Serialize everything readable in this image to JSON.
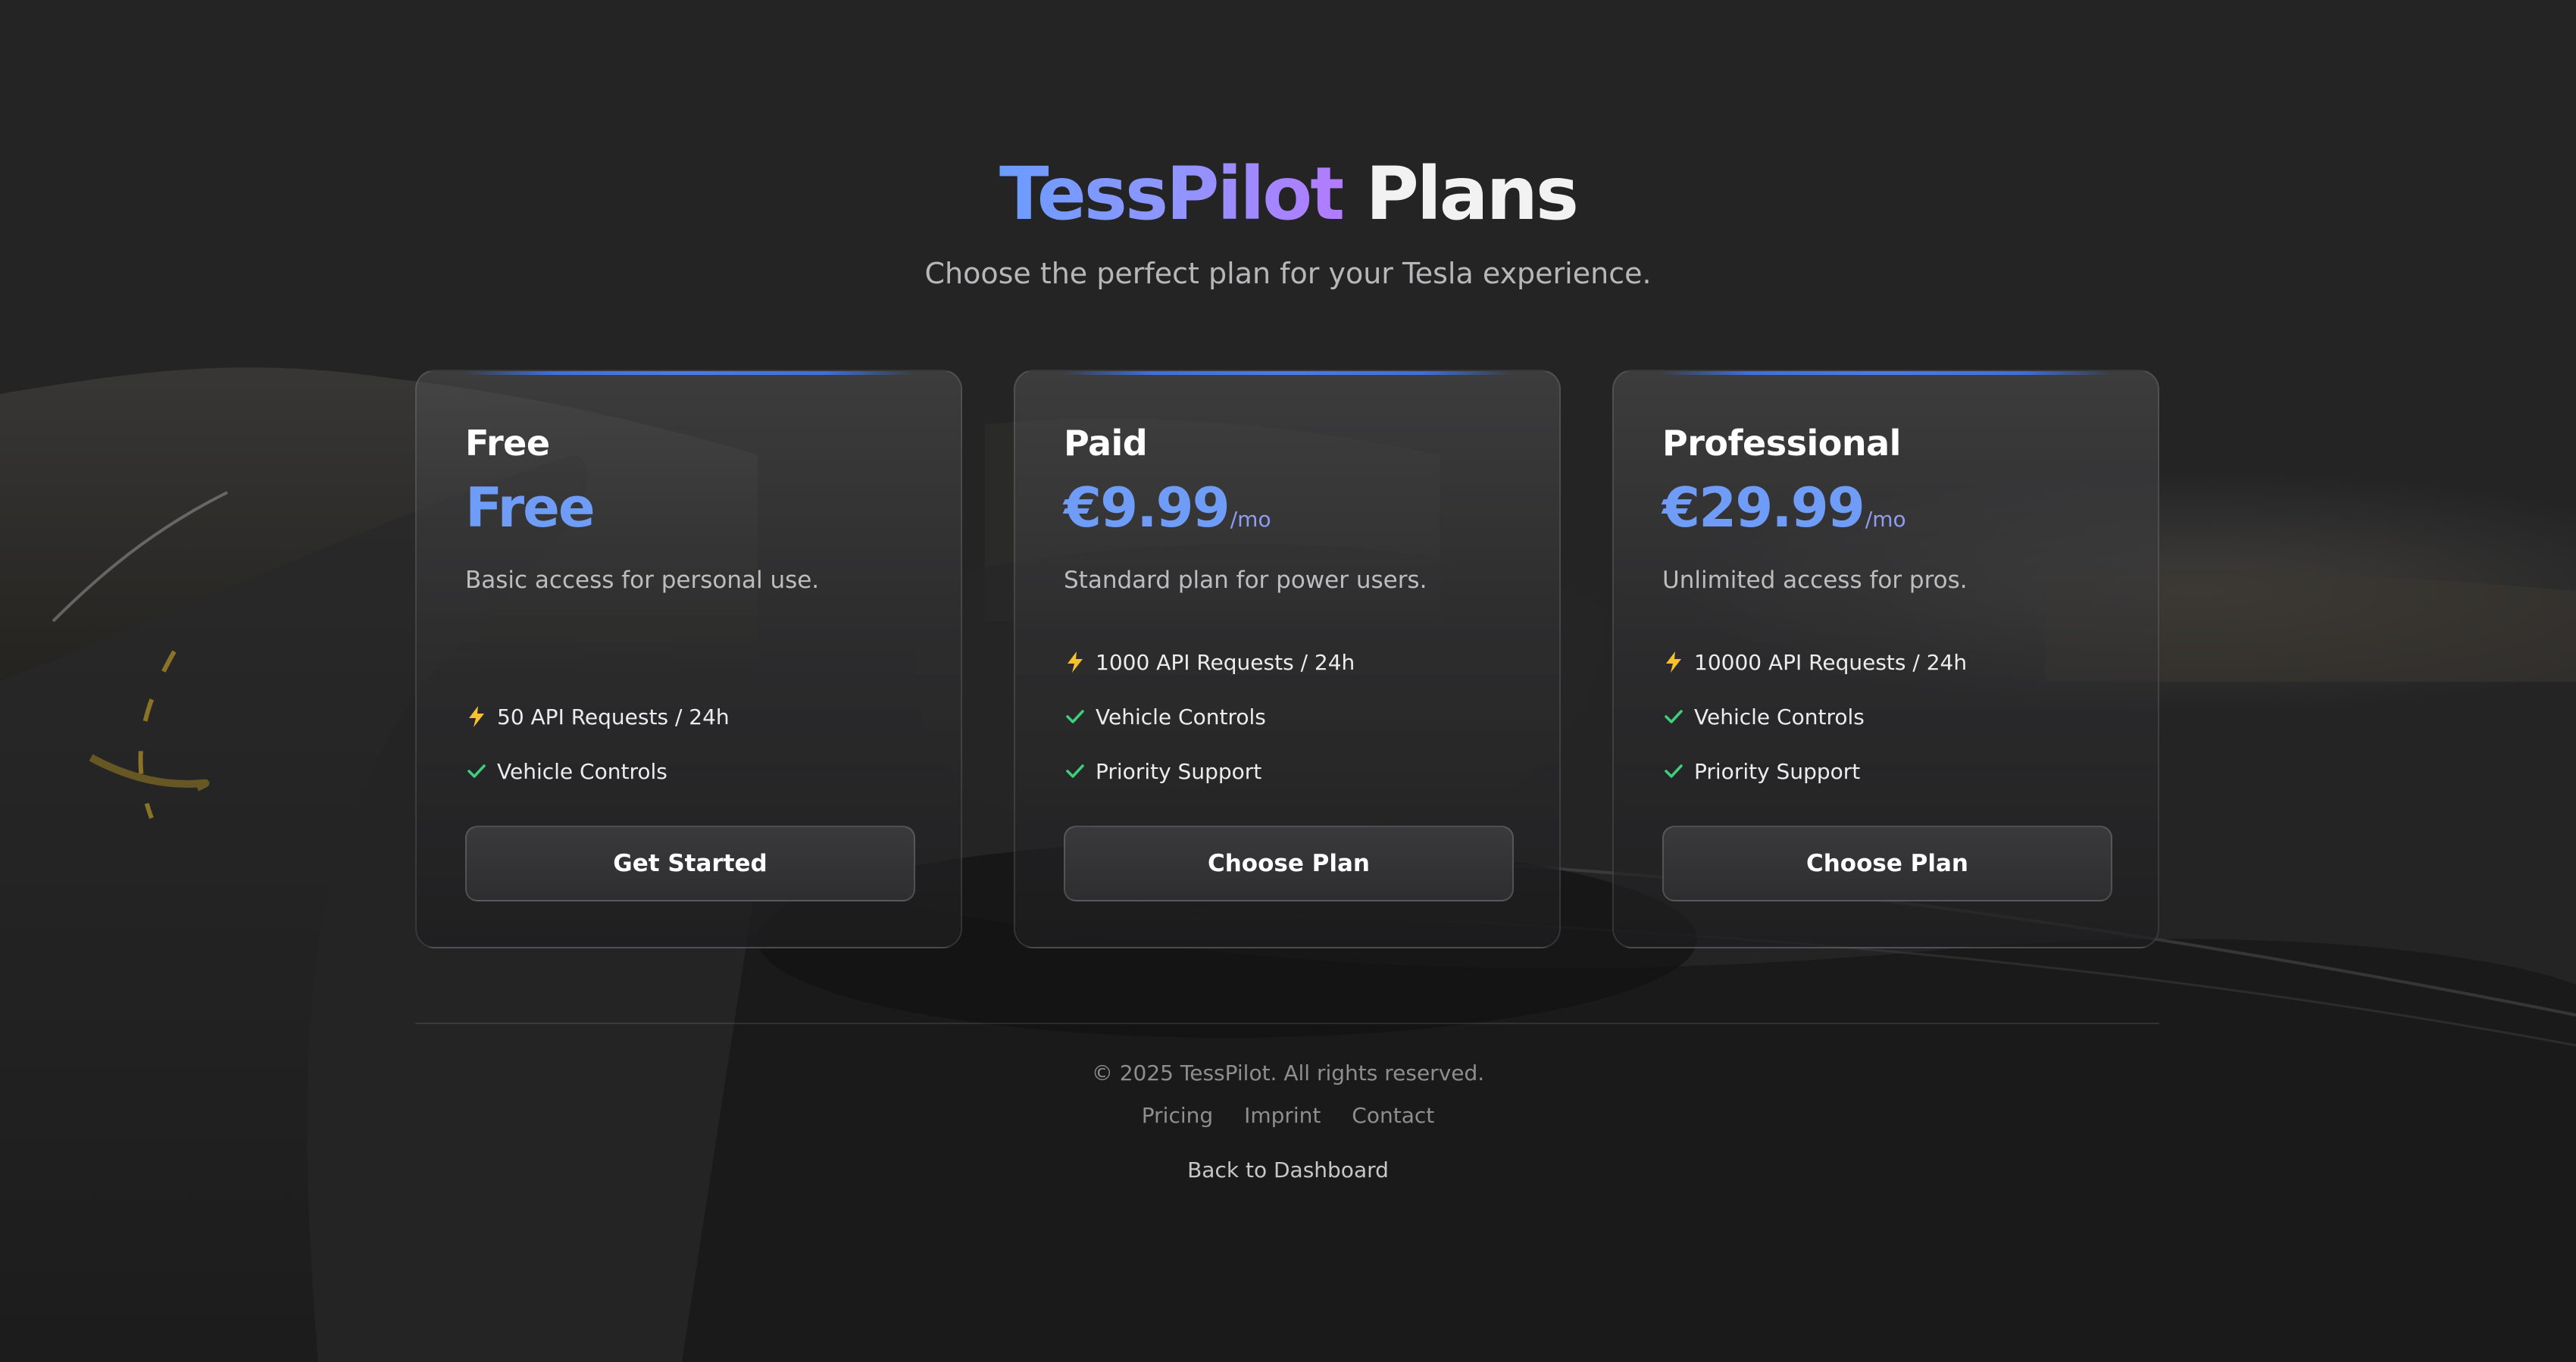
{
  "header": {
    "brand": "TessPilot",
    "title_rest": "Plans",
    "subtitle": "Choose the perfect plan for your Tesla experience."
  },
  "plans": [
    {
      "name": "Free",
      "price": "Free",
      "period": "",
      "description": "Basic access for personal use.",
      "features": [
        {
          "icon": "lightning-icon",
          "text": "50 API Requests / 24h"
        },
        {
          "icon": "check-icon",
          "text": "Vehicle Controls"
        }
      ],
      "button": "Get Started"
    },
    {
      "name": "Paid",
      "price": "€9.99",
      "period": "/mo",
      "description": "Standard plan for power users.",
      "features": [
        {
          "icon": "lightning-icon",
          "text": "1000 API Requests / 24h"
        },
        {
          "icon": "check-icon",
          "text": "Vehicle Controls"
        },
        {
          "icon": "check-icon",
          "text": "Priority Support"
        }
      ],
      "button": "Choose Plan"
    },
    {
      "name": "Professional",
      "price": "€29.99",
      "period": "/mo",
      "description": "Unlimited access for pros.",
      "features": [
        {
          "icon": "lightning-icon",
          "text": "10000 API Requests / 24h"
        },
        {
          "icon": "check-icon",
          "text": "Vehicle Controls"
        },
        {
          "icon": "check-icon",
          "text": "Priority Support"
        }
      ],
      "button": "Choose Plan"
    }
  ],
  "footer": {
    "copyright": "© 2025 TessPilot. All rights reserved.",
    "links": [
      "Pricing",
      "Imprint",
      "Contact"
    ],
    "back_link": "Back to Dashboard"
  },
  "colors": {
    "accent_blue": "#6f9cf7",
    "accent_purple": "#b27bff",
    "check_green": "#3ecf7a",
    "lightning_yellow": "#f5c22e"
  }
}
